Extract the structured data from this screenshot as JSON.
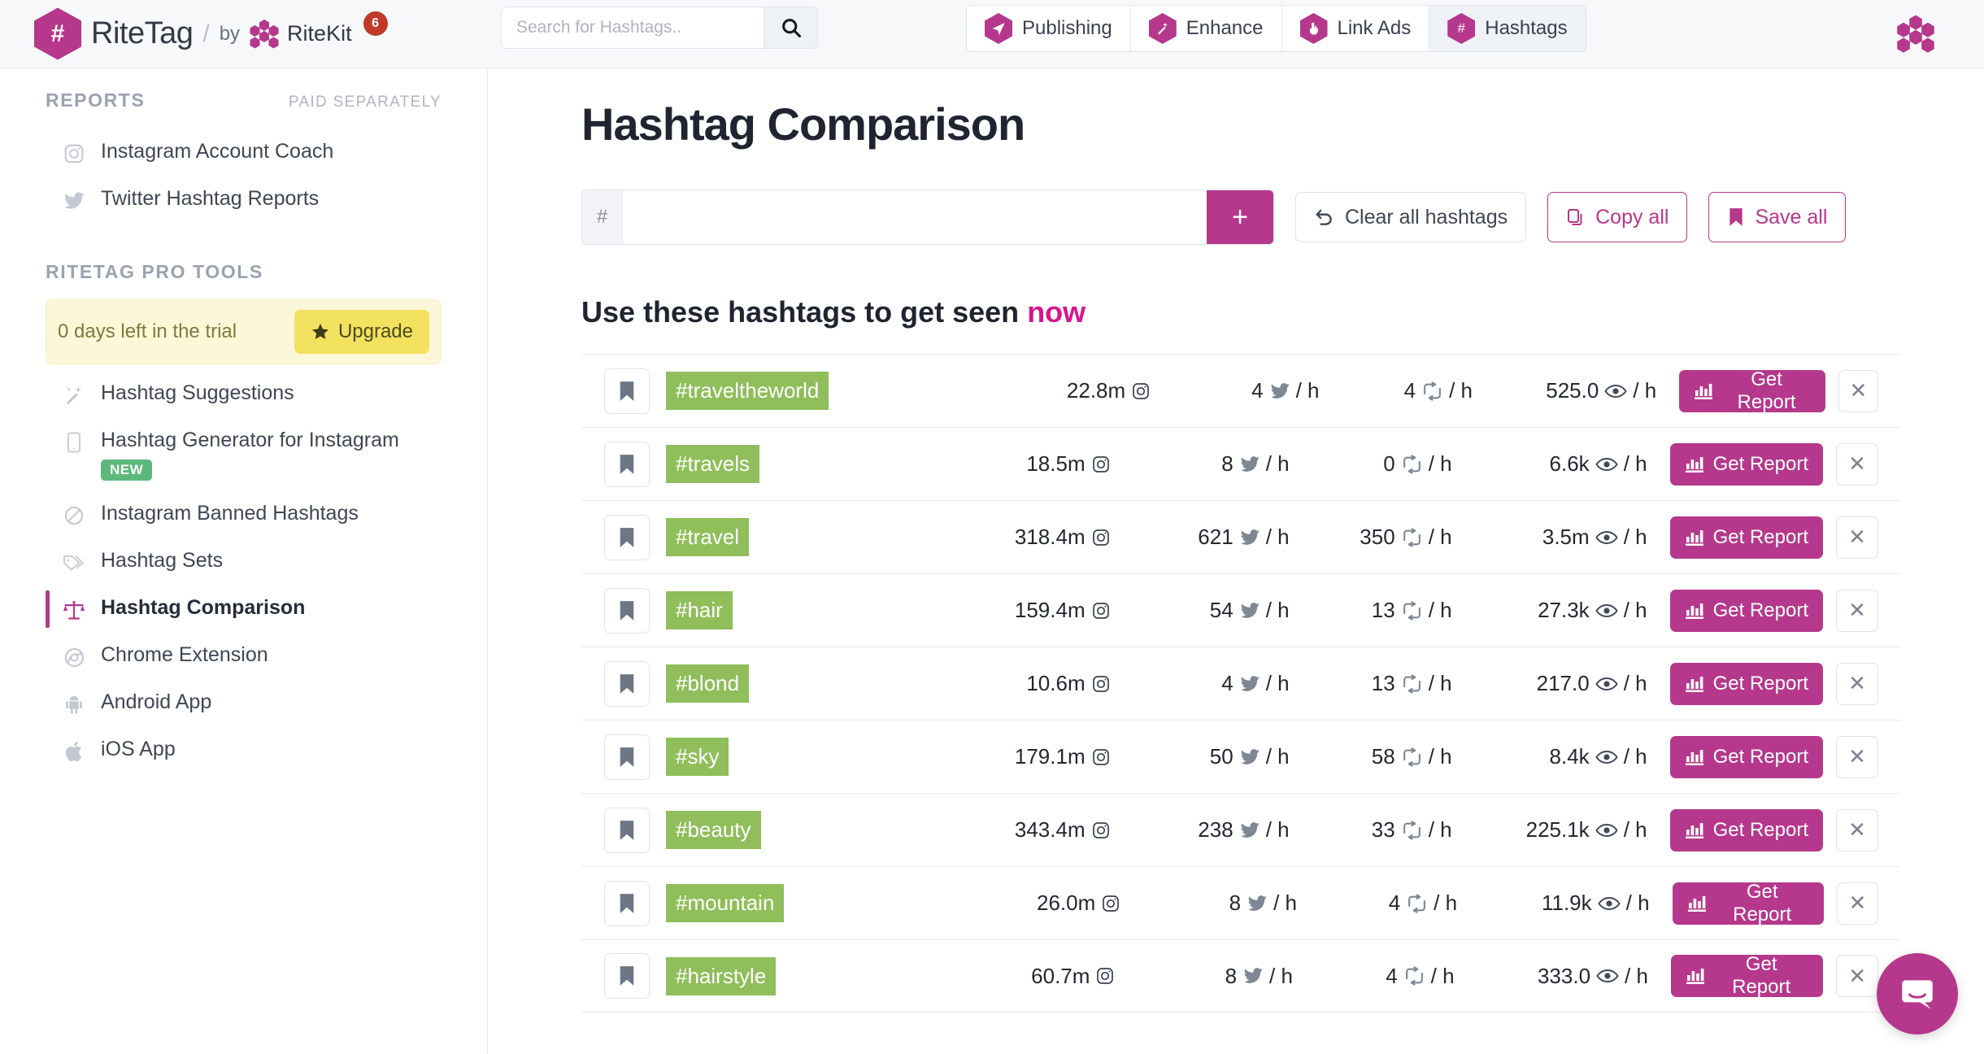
{
  "brand": {
    "hash_symbol": "#",
    "name": "RiteTag",
    "slash": "/",
    "by": "by",
    "kit": "RiteKit",
    "notification_count": "6",
    "accent_color": "#b5388c",
    "tag_green": "#8fbe5a"
  },
  "search": {
    "placeholder": "Search for Hashtags..",
    "value": "",
    "icon": "search-icon"
  },
  "nav_tabs": [
    {
      "label": "Publishing",
      "icon": "paper-plane-icon",
      "active": false
    },
    {
      "label": "Enhance",
      "icon": "magic-wand-icon",
      "active": false
    },
    {
      "label": "Link Ads",
      "icon": "hand-pointer-icon",
      "active": false
    },
    {
      "label": "Hashtags",
      "icon": "hash-icon",
      "active": true
    }
  ],
  "sidebar": {
    "reports_heading": "REPORTS",
    "reports_note": "PAID SEPARATELY",
    "reports_items": [
      {
        "label": "Instagram Account Coach",
        "icon": "instagram-icon"
      },
      {
        "label": "Twitter Hashtag Reports",
        "icon": "twitter-icon"
      }
    ],
    "pro_heading": "RITETAG PRO TOOLS",
    "trial": {
      "text": "0 days left in the trial",
      "upgrade_label": "Upgrade",
      "upgrade_icon": "star-icon"
    },
    "pro_items": [
      {
        "label": "Hashtag Suggestions",
        "icon": "magic-wand-icon",
        "badge": "",
        "active": false
      },
      {
        "label": "Hashtag Generator for Instagram",
        "icon": "mobile-icon",
        "badge": "NEW",
        "active": false
      },
      {
        "label": "Instagram Banned Hashtags",
        "icon": "ban-icon",
        "badge": "",
        "active": false
      },
      {
        "label": "Hashtag Sets",
        "icon": "tags-icon",
        "badge": "",
        "active": false
      },
      {
        "label": "Hashtag Comparison",
        "icon": "balance-scale-icon",
        "badge": "",
        "active": true
      },
      {
        "label": "Chrome Extension",
        "icon": "chrome-icon",
        "badge": "",
        "active": false
      },
      {
        "label": "Android App",
        "icon": "android-icon",
        "badge": "",
        "active": false
      },
      {
        "label": "iOS App",
        "icon": "apple-icon",
        "badge": "",
        "active": false
      }
    ]
  },
  "main": {
    "page_title": "Hashtag Comparison",
    "add_prefix": "#",
    "add_value": "",
    "add_placeholder": "",
    "add_button_label": "+",
    "clear_label": "Clear all hashtags",
    "copy_label": "Copy all",
    "save_label": "Save all",
    "section_title_a": "Use these hashtags to get seen ",
    "section_title_b": "now",
    "report_label": "Get Report",
    "per_hour": "/ h"
  },
  "table_rows": [
    {
      "tag": "#traveltheworld",
      "instagram": "22.8m",
      "tweets": "4",
      "retweets": "4",
      "views": "525.0"
    },
    {
      "tag": "#travels",
      "instagram": "18.5m",
      "tweets": "8",
      "retweets": "0",
      "views": "6.6k"
    },
    {
      "tag": "#travel",
      "instagram": "318.4m",
      "tweets": "621",
      "retweets": "350",
      "views": "3.5m"
    },
    {
      "tag": "#hair",
      "instagram": "159.4m",
      "tweets": "54",
      "retweets": "13",
      "views": "27.3k"
    },
    {
      "tag": "#blond",
      "instagram": "10.6m",
      "tweets": "4",
      "retweets": "13",
      "views": "217.0"
    },
    {
      "tag": "#sky",
      "instagram": "179.1m",
      "tweets": "50",
      "retweets": "58",
      "views": "8.4k"
    },
    {
      "tag": "#beauty",
      "instagram": "343.4m",
      "tweets": "238",
      "retweets": "33",
      "views": "225.1k"
    },
    {
      "tag": "#mountain",
      "instagram": "26.0m",
      "tweets": "8",
      "retweets": "4",
      "views": "11.9k"
    },
    {
      "tag": "#hairstyle",
      "instagram": "60.7m",
      "tweets": "8",
      "retweets": "4",
      "views": "333.0"
    }
  ],
  "chat": {
    "icon": "intercom-chat-icon"
  }
}
